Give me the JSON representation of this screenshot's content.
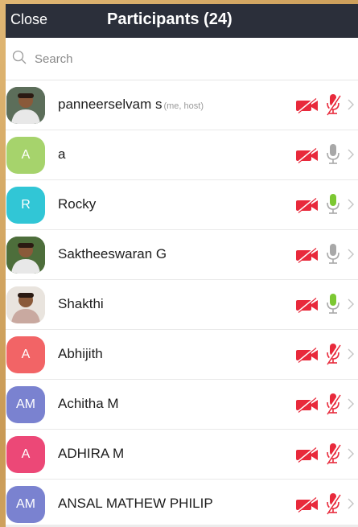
{
  "header": {
    "close_label": "Close",
    "title": "Participants (24)"
  },
  "search": {
    "placeholder": "Search"
  },
  "colors": {
    "header_bg": "#2b2f3a",
    "muted_red": "#e8293b",
    "mic_active_green": "#7cc832",
    "mic_inactive_gray": "#a8a8a8"
  },
  "participants": [
    {
      "name": "panneerselvam s",
      "tag": "(me, host)",
      "initials": "",
      "avatar_type": "photo",
      "avatar_color": "#5c6e5a",
      "video": "off",
      "mic": "muted"
    },
    {
      "name": "a",
      "tag": "",
      "initials": "A",
      "avatar_type": "initials",
      "avatar_color": "#a6d36c",
      "video": "off",
      "mic": "inactive"
    },
    {
      "name": "Rocky",
      "tag": "",
      "initials": "R",
      "avatar_type": "initials",
      "avatar_color": "#31c6d6",
      "video": "off",
      "mic": "active"
    },
    {
      "name": "Saktheeswaran G",
      "tag": "",
      "initials": "",
      "avatar_type": "photo",
      "avatar_color": "#4d6e3b",
      "video": "off",
      "mic": "inactive"
    },
    {
      "name": "Shakthi",
      "tag": "",
      "initials": "",
      "avatar_type": "photo",
      "avatar_color": "#e9e4de",
      "video": "off",
      "mic": "active"
    },
    {
      "name": "Abhijith",
      "tag": "",
      "initials": "A",
      "avatar_type": "initials",
      "avatar_color": "#f26466",
      "video": "off",
      "mic": "muted"
    },
    {
      "name": "Achitha M",
      "tag": "",
      "initials": "AM",
      "avatar_type": "initials",
      "avatar_color": "#7a82d0",
      "video": "off",
      "mic": "muted"
    },
    {
      "name": "ADHIRA M",
      "tag": "",
      "initials": "A",
      "avatar_type": "initials",
      "avatar_color": "#ec4877",
      "video": "off",
      "mic": "muted"
    },
    {
      "name": "ANSAL MATHEW PHILIP",
      "tag": "",
      "initials": "AM",
      "avatar_type": "initials",
      "avatar_color": "#7a82d0",
      "video": "off",
      "mic": "muted"
    }
  ]
}
